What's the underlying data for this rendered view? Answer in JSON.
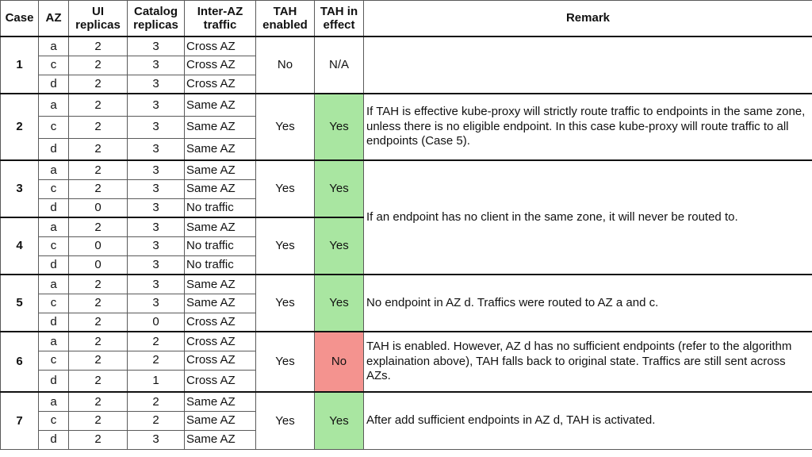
{
  "header": {
    "case": "Case",
    "az": "AZ",
    "ui_replicas": "UI replicas",
    "catalog_replicas": "Catalog replicas",
    "inter_az_traffic": "Inter-AZ traffic",
    "tah_enabled": "TAH enabled",
    "tah_in_effect": "TAH in effect",
    "remark": "Remark"
  },
  "colors": {
    "yes_effect": "#a9e6a1",
    "no_effect": "#f4938f"
  },
  "cases": [
    {
      "case": "1",
      "tah_enabled": "No",
      "tah_in_effect": "N/A",
      "remark": "",
      "rows": [
        {
          "az": "a",
          "ui": "2",
          "catalog": "3",
          "traffic": "Cross AZ"
        },
        {
          "az": "c",
          "ui": "2",
          "catalog": "3",
          "traffic": "Cross AZ"
        },
        {
          "az": "d",
          "ui": "2",
          "catalog": "3",
          "traffic": "Cross AZ"
        }
      ]
    },
    {
      "case": "2",
      "tah_enabled": "Yes",
      "tah_in_effect": "Yes",
      "remark": "If TAH is effective kube-proxy will strictly route traffic to endpoints in the same zone, unless there is no eligible endpoint. In this case kube-proxy will route traffic to all endpoints (Case 5).",
      "rows": [
        {
          "az": "a",
          "ui": "2",
          "catalog": "3",
          "traffic": "Same AZ"
        },
        {
          "az": "c",
          "ui": "2",
          "catalog": "3",
          "traffic": "Same AZ"
        },
        {
          "az": "d",
          "ui": "2",
          "catalog": "3",
          "traffic": "Same AZ"
        }
      ]
    },
    {
      "case": "3",
      "tah_enabled": "Yes",
      "tah_in_effect": "Yes",
      "rows": [
        {
          "az": "a",
          "ui": "2",
          "catalog": "3",
          "traffic": "Same AZ"
        },
        {
          "az": "c",
          "ui": "2",
          "catalog": "3",
          "traffic": "Same AZ"
        },
        {
          "az": "d",
          "ui": "0",
          "catalog": "3",
          "traffic": "No traffic"
        }
      ]
    },
    {
      "case": "4",
      "tah_enabled": "Yes",
      "tah_in_effect": "Yes",
      "rows": [
        {
          "az": "a",
          "ui": "2",
          "catalog": "3",
          "traffic": "Same AZ"
        },
        {
          "az": "c",
          "ui": "0",
          "catalog": "3",
          "traffic": "No traffic"
        },
        {
          "az": "d",
          "ui": "0",
          "catalog": "3",
          "traffic": "No traffic"
        }
      ]
    },
    {
      "case": "5",
      "tah_enabled": "Yes",
      "tah_in_effect": "Yes",
      "remark": "No endpoint in AZ d. Traffics were routed to AZ a and c.",
      "rows": [
        {
          "az": "a",
          "ui": "2",
          "catalog": "3",
          "traffic": "Same AZ"
        },
        {
          "az": "c",
          "ui": "2",
          "catalog": "3",
          "traffic": "Same AZ"
        },
        {
          "az": "d",
          "ui": "2",
          "catalog": "0",
          "traffic": "Cross AZ"
        }
      ]
    },
    {
      "case": "6",
      "tah_enabled": "Yes",
      "tah_in_effect": "No",
      "remark": "TAH is enabled. However, AZ d has no sufficient endpoints (refer to the algorithm explaination above), TAH falls back to original state. Traffics are still sent across AZs.",
      "rows": [
        {
          "az": "a",
          "ui": "2",
          "catalog": "2",
          "traffic": "Cross AZ"
        },
        {
          "az": "c",
          "ui": "2",
          "catalog": "2",
          "traffic": "Cross AZ"
        },
        {
          "az": "d",
          "ui": "2",
          "catalog": "1",
          "traffic": "Cross AZ"
        }
      ]
    },
    {
      "case": "7",
      "tah_enabled": "Yes",
      "tah_in_effect": "Yes",
      "remark": "After add sufficient endpoints in AZ d, TAH is activated.",
      "rows": [
        {
          "az": "a",
          "ui": "2",
          "catalog": "2",
          "traffic": "Same AZ"
        },
        {
          "az": "c",
          "ui": "2",
          "catalog": "2",
          "traffic": "Same AZ"
        },
        {
          "az": "d",
          "ui": "2",
          "catalog": "3",
          "traffic": "Same AZ"
        }
      ]
    }
  ],
  "shared_remark_3_4": "If an endpoint has no client in the same zone, it will never be routed to."
}
